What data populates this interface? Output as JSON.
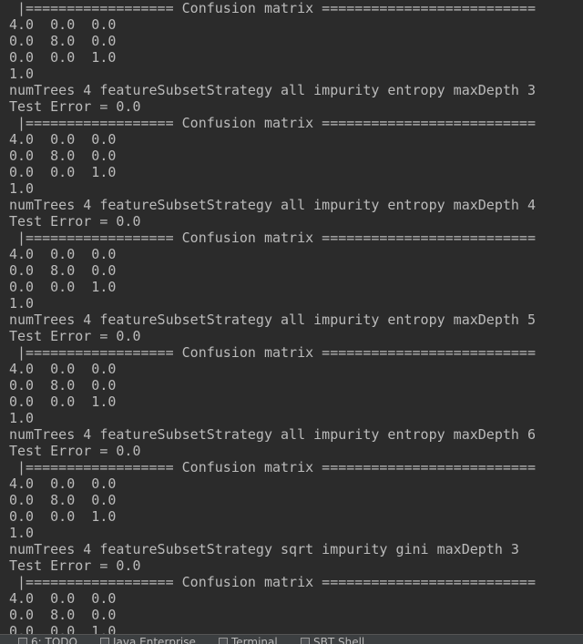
{
  "console": {
    "lines": [
      " |================== Confusion matrix ==========================",
      "4.0  0.0  0.0",
      "0.0  8.0  0.0",
      "0.0  0.0  1.0",
      "1.0",
      "numTrees 4 featureSubsetStrategy all impurity entropy maxDepth 3",
      "Test Error = 0.0",
      " |================== Confusion matrix ==========================",
      "4.0  0.0  0.0",
      "0.0  8.0  0.0",
      "0.0  0.0  1.0",
      "1.0",
      "numTrees 4 featureSubsetStrategy all impurity entropy maxDepth 4",
      "Test Error = 0.0",
      " |================== Confusion matrix ==========================",
      "4.0  0.0  0.0",
      "0.0  8.0  0.0",
      "0.0  0.0  1.0",
      "1.0",
      "numTrees 4 featureSubsetStrategy all impurity entropy maxDepth 5",
      "Test Error = 0.0",
      " |================== Confusion matrix ==========================",
      "4.0  0.0  0.0",
      "0.0  8.0  0.0",
      "0.0  0.0  1.0",
      "1.0",
      "numTrees 4 featureSubsetStrategy all impurity entropy maxDepth 6",
      "Test Error = 0.0",
      " |================== Confusion matrix ==========================",
      "4.0  0.0  0.0",
      "0.0  8.0  0.0",
      "0.0  0.0  1.0",
      "1.0",
      "numTrees 4 featureSubsetStrategy sqrt impurity gini maxDepth 3",
      "Test Error = 0.0",
      " |================== Confusion matrix ==========================",
      "4.0  0.0  0.0",
      "0.0  8.0  0.0",
      "0.0  0.0  1.0"
    ]
  },
  "status_bar": {
    "tabs": [
      {
        "label": "6: TODO",
        "icon": "todo-icon"
      },
      {
        "label": "Java Enterprise",
        "icon": "java-enterprise-icon"
      },
      {
        "label": "Terminal",
        "icon": "terminal-icon"
      },
      {
        "label": "SBT Shell",
        "icon": "sbt-shell-icon"
      }
    ]
  },
  "colors": {
    "background": "#2b2b2b",
    "text": "#bbbbbb",
    "status_bar": "#3c3f41"
  }
}
